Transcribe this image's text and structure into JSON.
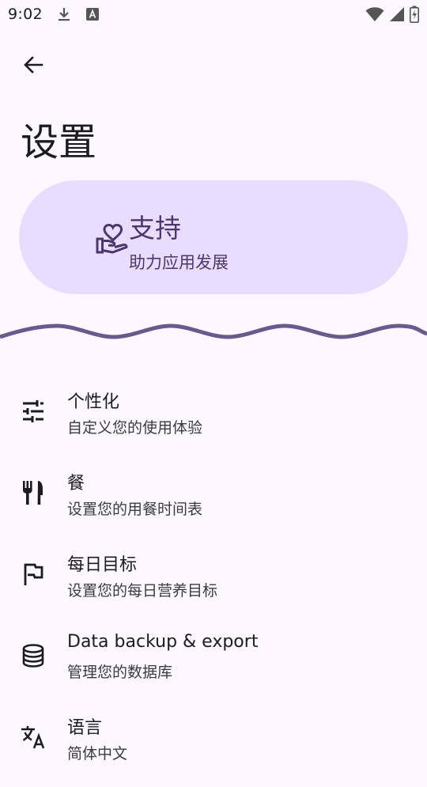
{
  "status_bar": {
    "time": "9:02"
  },
  "header": {
    "title": "设置"
  },
  "support": {
    "title": "支持",
    "subtitle": "助力应用发展"
  },
  "settings": [
    {
      "title": "个性化",
      "subtitle": "自定义您的使用体验",
      "icon": "tune-icon"
    },
    {
      "title": "餐",
      "subtitle": "设置您的用餐时间表",
      "icon": "restaurant-icon"
    },
    {
      "title": "每日目标",
      "subtitle": "设置您的每日营养目标",
      "icon": "flag-icon"
    },
    {
      "title": "Data backup & export",
      "subtitle": "管理您的数据库",
      "icon": "database-icon"
    },
    {
      "title": "语言",
      "subtitle": "简体中文",
      "icon": "translate-icon"
    }
  ],
  "colors": {
    "background": "#fdf7ff",
    "support_card": "#e8ddfe",
    "accent": "#6a5f96",
    "text": "#1d1b20"
  }
}
